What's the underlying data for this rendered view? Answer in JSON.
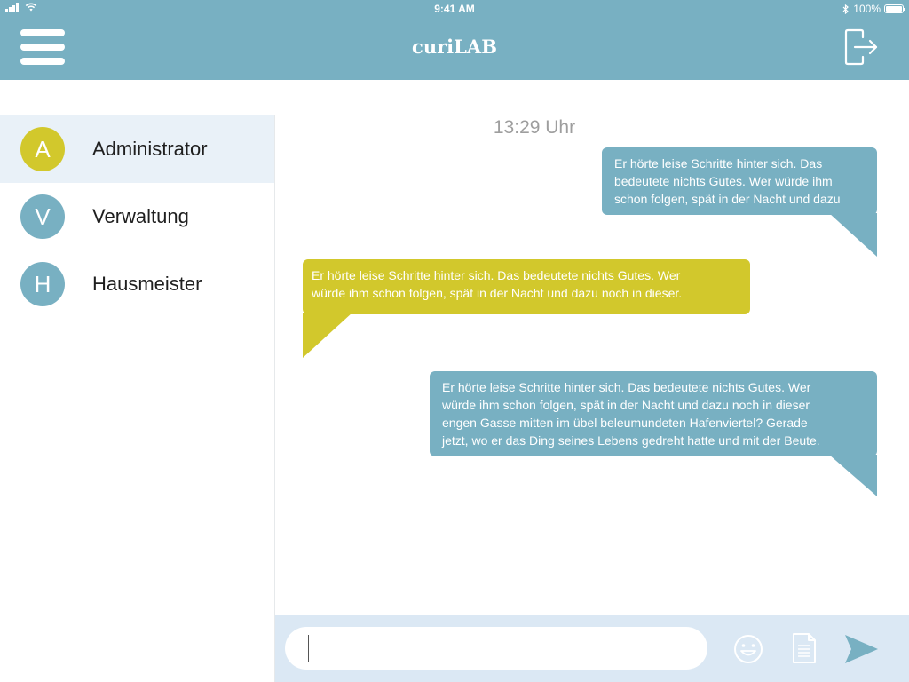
{
  "status_bar": {
    "time": "9:41 AM",
    "battery_text": "100%",
    "battery_level_pct": 100
  },
  "header": {
    "title": "curiLAB",
    "menu_icon": "hamburger-menu-icon",
    "logout_icon": "logout-icon"
  },
  "colors": {
    "primary": "#78b0c2",
    "accent_yellow": "#d2c82c",
    "sidebar_active": "#e9f1f8",
    "composer_bg": "#dbe8f4"
  },
  "sidebar": {
    "contacts": [
      {
        "initial": "A",
        "name": "Administrator",
        "color": "#d2c82c",
        "active": true
      },
      {
        "initial": "V",
        "name": "Verwaltung",
        "color": "#78b0c2",
        "active": false
      },
      {
        "initial": "H",
        "name": "Hausmeister",
        "color": "#78b0c2",
        "active": false
      }
    ]
  },
  "chat": {
    "timestamp": "13:29 Uhr",
    "messages": [
      {
        "side": "outgoing",
        "color": "blue",
        "lines": [
          "Er hörte leise Schritte hinter sich. Das",
          "bedeutete nichts Gutes. Wer würde ihm",
          "schon folgen, spät in der Nacht und dazu"
        ]
      },
      {
        "side": "incoming",
        "color": "yellow",
        "lines": [
          "Er hörte leise Schritte hinter sich. Das bedeutete nichts Gutes. Wer",
          "würde ihm schon folgen, spät in der Nacht und dazu noch in dieser."
        ]
      },
      {
        "side": "outgoing",
        "color": "blue",
        "lines": [
          "Er hörte leise Schritte hinter sich. Das bedeutete nichts Gutes. Wer",
          "würde ihm schon folgen, spät in der Nacht und dazu noch in dieser",
          "engen Gasse mitten im übel beleumundeten Hafenviertel? Gerade",
          "jetzt, wo er das Ding seines Lebens gedreht hatte und mit der Beute."
        ]
      }
    ]
  },
  "composer": {
    "input_value": "",
    "emoji_icon": "smiley-icon",
    "attachment_icon": "document-icon",
    "send_icon": "send-arrow-icon"
  }
}
